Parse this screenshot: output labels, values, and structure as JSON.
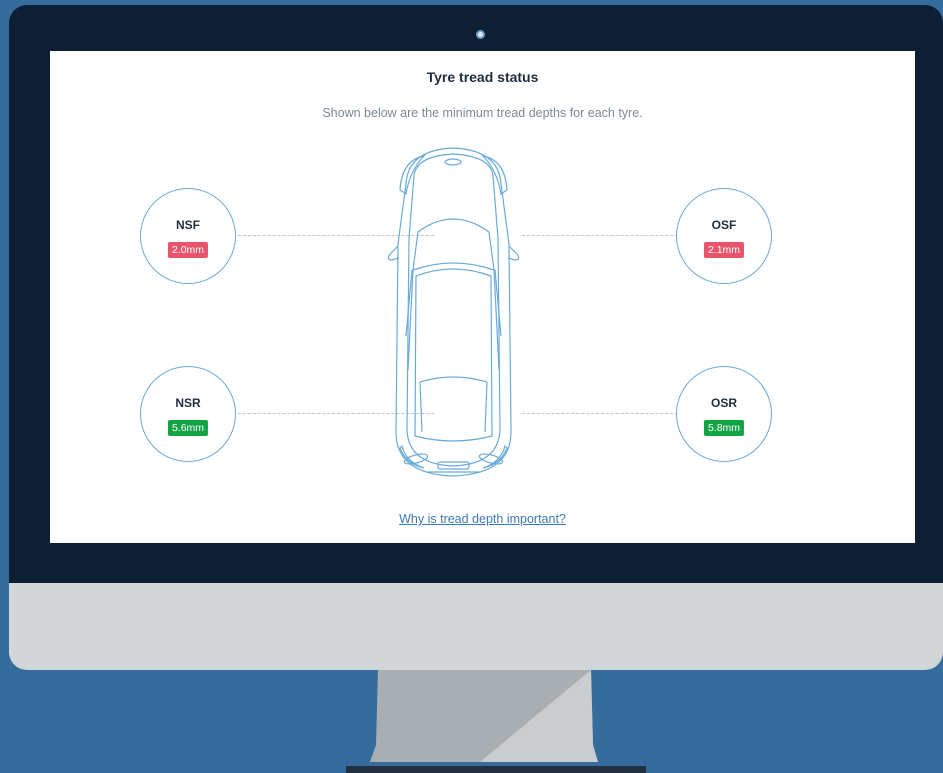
{
  "page": {
    "title": "Tyre tread status",
    "subtitle": "Shown below are the minimum tread depths for each tyre.",
    "link_label": "Why is tread depth important?"
  },
  "tyres": {
    "nsf": {
      "label": "NSF",
      "value": "2.0mm",
      "status": "bad"
    },
    "osf": {
      "label": "OSF",
      "value": "2.1mm",
      "status": "bad"
    },
    "nsr": {
      "label": "NSR",
      "value": "5.6mm",
      "status": "good"
    },
    "osr": {
      "label": "OSR",
      "value": "5.8mm",
      "status": "good"
    }
  },
  "colors": {
    "background": "#356c9d",
    "bezel": "#0e1e33",
    "accent": "#6aaad8",
    "bad_badge": "#e8546c",
    "good_badge": "#13a244",
    "link": "#3d7ab8"
  }
}
